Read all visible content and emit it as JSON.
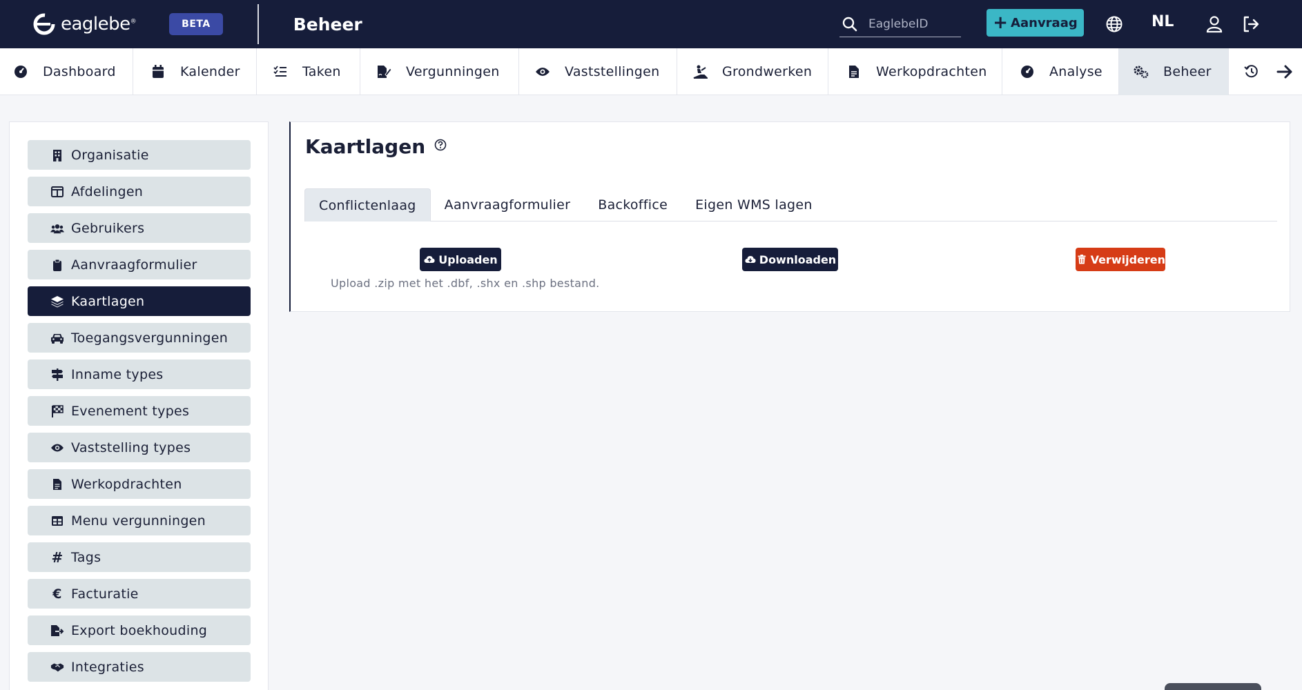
{
  "header": {
    "logo_text": "eaglebe",
    "logo_reg": "®",
    "beta_label": "BETA",
    "page_title": "Beheer",
    "search_placeholder": "EaglebeID",
    "aanvraag_label": "Aanvraag",
    "language": "NL"
  },
  "nav": {
    "items": [
      {
        "label": "Dashboard",
        "icon": "gauge-icon"
      },
      {
        "label": "Kalender",
        "icon": "calendar-icon"
      },
      {
        "label": "Taken",
        "icon": "checklist-icon"
      },
      {
        "label": "Vergunningen",
        "icon": "file-signature-icon"
      },
      {
        "label": "Vaststellingen",
        "icon": "eye-icon"
      },
      {
        "label": "Grondwerken",
        "icon": "digging-icon"
      },
      {
        "label": "Werkopdrachten",
        "icon": "document-icon"
      },
      {
        "label": "Analyse",
        "icon": "gauge-icon"
      },
      {
        "label": "Beheer",
        "icon": "gears-icon"
      }
    ]
  },
  "sidebar": {
    "items": [
      {
        "label": "Organisatie",
        "icon": "building-icon"
      },
      {
        "label": "Afdelingen",
        "icon": "table-columns-icon"
      },
      {
        "label": "Gebruikers",
        "icon": "users-icon"
      },
      {
        "label": "Aanvraagformulier",
        "icon": "clipboard-icon"
      },
      {
        "label": "Kaartlagen",
        "icon": "layers-icon"
      },
      {
        "label": "Toegangsvergunningen",
        "icon": "car-icon"
      },
      {
        "label": "Inname types",
        "icon": "signs-icon"
      },
      {
        "label": "Evenement types",
        "icon": "flag-checkered-icon"
      },
      {
        "label": "Vaststelling types",
        "icon": "eye-icon"
      },
      {
        "label": "Werkopdrachten",
        "icon": "document-icon"
      },
      {
        "label": "Menu vergunningen",
        "icon": "table-icon"
      },
      {
        "label": "Tags",
        "icon": "hashtag-icon"
      },
      {
        "label": "Facturatie",
        "icon": "euro-icon"
      },
      {
        "label": "Export boekhouding",
        "icon": "file-export-icon"
      },
      {
        "label": "Integraties",
        "icon": "handshake-icon"
      }
    ]
  },
  "main": {
    "title": "Kaartlagen",
    "tabs": [
      "Conflictenlaag",
      "Aanvraagformulier",
      "Backoffice",
      "Eigen WMS lagen"
    ],
    "upload_label": "Uploaden",
    "download_label": "Downloaden",
    "delete_label": "Verwijderen",
    "upload_hint": "Upload .zip met het .dbf, .shx en .shp bestand."
  },
  "colors": {
    "topbar": "#161d3a",
    "accent": "#3bb7c6",
    "danger": "#d63c16",
    "beta": "#3b4aa5"
  }
}
